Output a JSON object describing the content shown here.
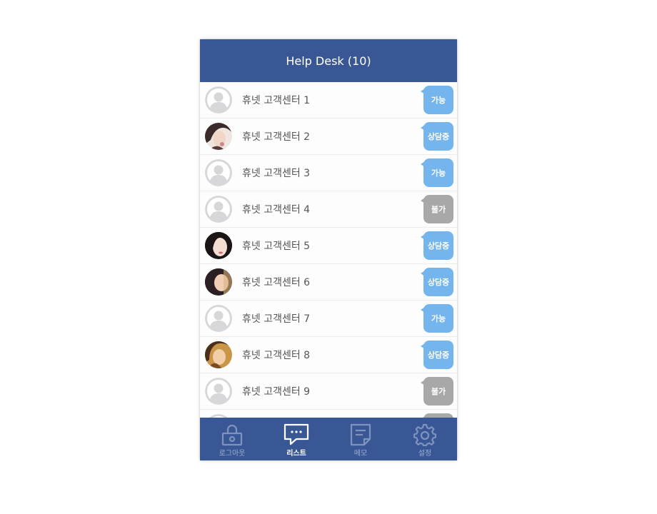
{
  "header": {
    "title": "Help Desk (10)"
  },
  "colors": {
    "brand": "#3a5795",
    "available": "#74b5ee",
    "unavailable": "#a8a8a8"
  },
  "items": [
    {
      "name": "휴넷 고객센터 1",
      "status": "가능",
      "avatar": "placeholder"
    },
    {
      "name": "휴넷 고객센터 2",
      "status": "상담중",
      "avatar": "photo"
    },
    {
      "name": "휴넷 고객센터 3",
      "status": "가능",
      "avatar": "placeholder"
    },
    {
      "name": "휴넷 고객센터 4",
      "status": "불가",
      "avatar": "placeholder"
    },
    {
      "name": "휴넷 고객센터 5",
      "status": "상담중",
      "avatar": "photo"
    },
    {
      "name": "휴넷 고객센터 6",
      "status": "상담중",
      "avatar": "photo"
    },
    {
      "name": "휴넷 고객센터 7",
      "status": "가능",
      "avatar": "placeholder"
    },
    {
      "name": "휴넷 고객센터 8",
      "status": "상담중",
      "avatar": "photo"
    },
    {
      "name": "휴넷 고객센터 9",
      "status": "불가",
      "avatar": "placeholder"
    },
    {
      "name": "",
      "status": "",
      "avatar": "placeholder"
    }
  ],
  "tabs": [
    {
      "label": "로그아웃",
      "icon": "lock-icon",
      "active": false
    },
    {
      "label": "리스트",
      "icon": "chat-bubble-icon",
      "active": true
    },
    {
      "label": "메모",
      "icon": "memo-icon",
      "active": false
    },
    {
      "label": "설정",
      "icon": "gear-icon",
      "active": false
    }
  ]
}
